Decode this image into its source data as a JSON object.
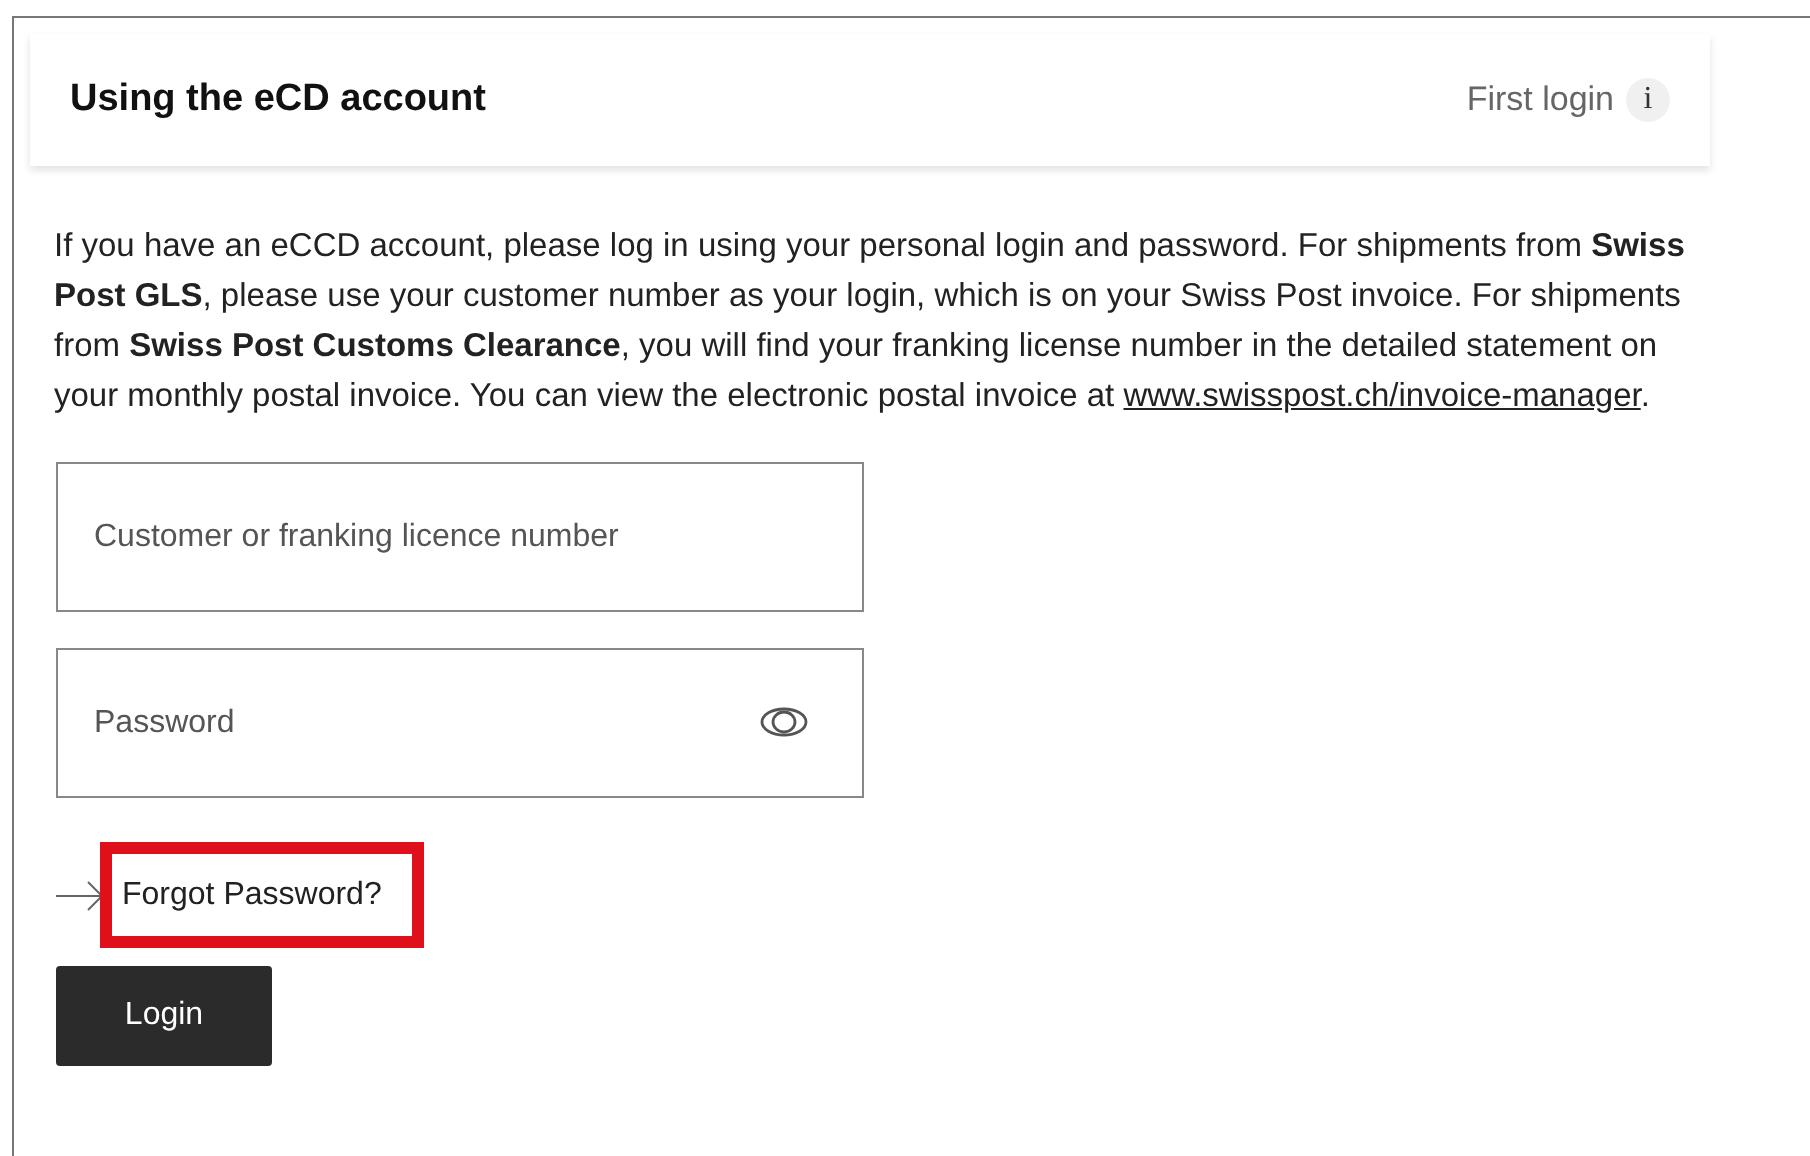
{
  "card": {
    "title": "Using the eCD account",
    "first_login": "First login",
    "info_glyph": "i"
  },
  "intro": {
    "text": "If you have an eCCD account, please log in using your personal login and password. For shipments from **Swiss Post GLS**, please use your customer number as your login, which is on your Swiss Post invoice. For shipments from **Swiss Post Customs Clearance**, you will find your franking license number in the detailed statement on your monthly postal invoice. You can view the electronic postal invoice at ",
    "link": "www.swisspost.ch/invoice-manager",
    "after": "."
  },
  "fields": [
    {
      "kind": "text",
      "placeholder": "Customer or franking licence number"
    },
    {
      "kind": "password",
      "placeholder": "Password"
    }
  ],
  "forgot_password": {
    "label": "Forgot Password?",
    "highlighted": true
  },
  "login_button": "Login"
}
